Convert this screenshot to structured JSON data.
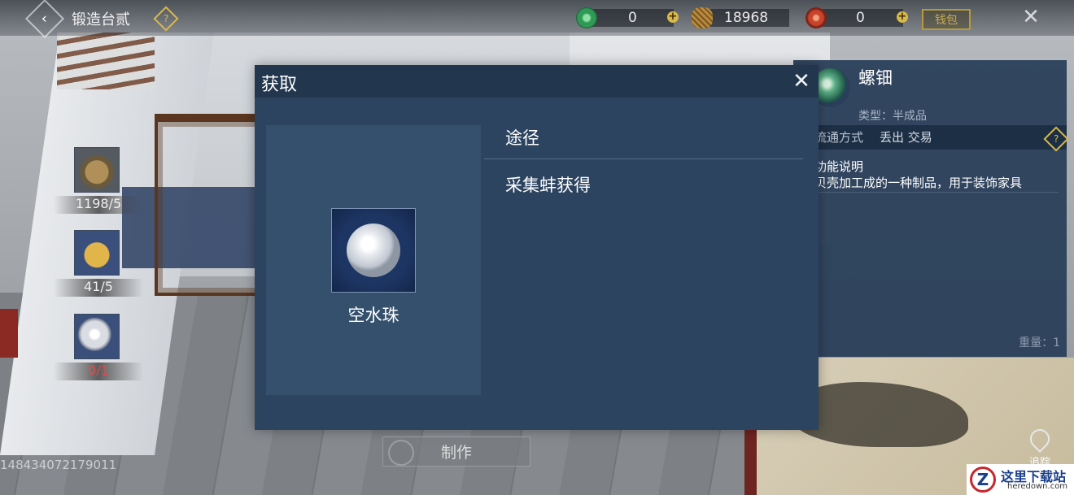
{
  "header": {
    "back_icon": "chevron-left-icon",
    "title": "锻造台贰",
    "help_glyph": "?",
    "currencies": [
      {
        "icon": "jade-coin-icon",
        "color": "#2f9a55",
        "value": "0"
      },
      {
        "icon": "copper-coin-icon",
        "color": "#b88a3c",
        "value": "18968"
      },
      {
        "icon": "red-spiral-icon",
        "color": "#c9432c",
        "value": "0"
      }
    ],
    "plus_glyph": "+",
    "wallet_label": "钱包",
    "close_glyph": "✕"
  },
  "materials": [
    {
      "icon": "ore-icon",
      "count": "1198/5",
      "sufficient": true
    },
    {
      "icon": "shell-icon",
      "count": "41/5",
      "sufficient": true
    },
    {
      "icon": "pearl-icon",
      "count": "0/1",
      "sufficient": false
    }
  ],
  "item_info": {
    "name": "螺钿",
    "type": "类型：半成品",
    "trade_label": "流通方式",
    "trade_value": "丢出 交易",
    "desc_title": "功能说明",
    "desc": "贝壳加工成的一种制品，用于装饰家具",
    "weight": "重量：1"
  },
  "dialog": {
    "title": "获取",
    "close_glyph": "✕",
    "item_name": "空水珠",
    "route_header": "途径",
    "routes": [
      "采集蚌获得"
    ]
  },
  "craft_button": "制作",
  "uid": "148434072179011",
  "track_label": "追踪",
  "watermark": {
    "cn": "这里下载站",
    "en": "heredown.com",
    "logo": "Z"
  }
}
